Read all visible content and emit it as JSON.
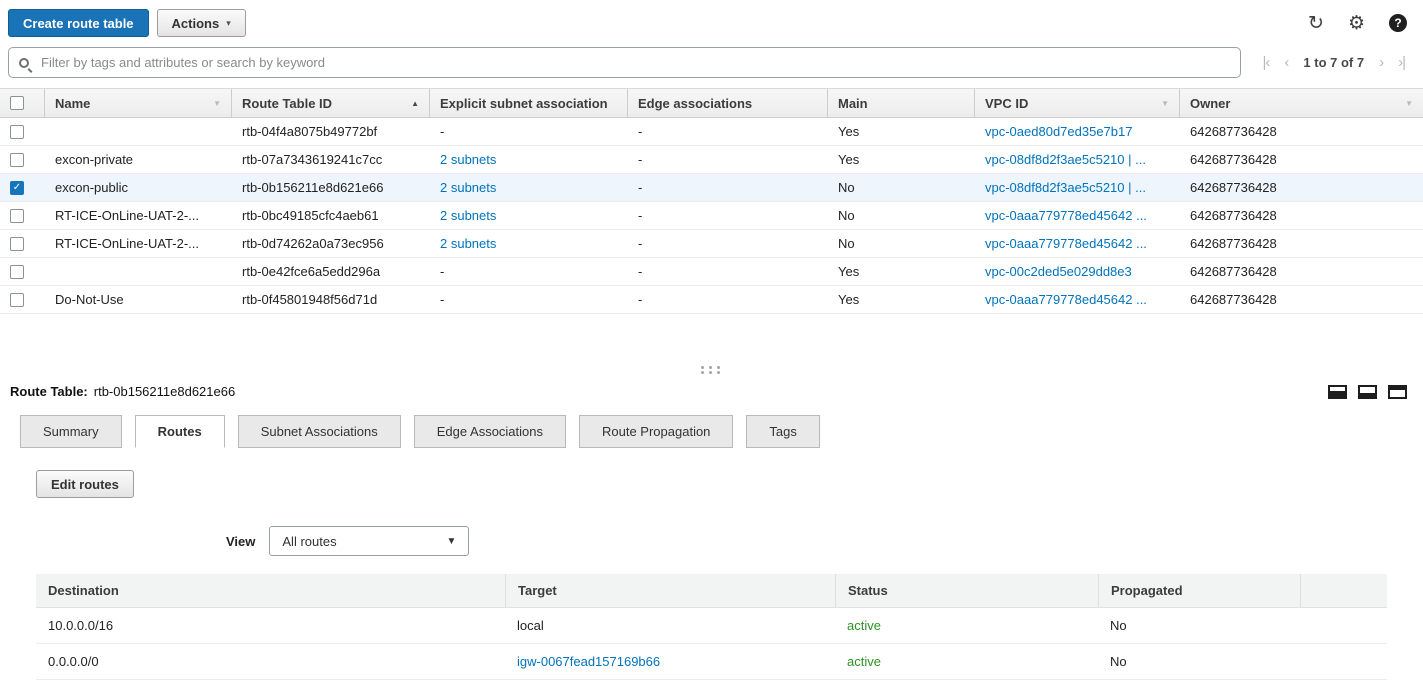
{
  "colors": {
    "primary_button": "#1a73b7",
    "link": "#0073bb",
    "status_active": "#2e9425",
    "selected_row": "#eef5fc",
    "checkbox_checked": "#1775bb"
  },
  "icons": {
    "refresh": "↻",
    "settings": "⚙",
    "help": "?",
    "check": "✓",
    "caret_down": "▼",
    "sort_asc": "▲",
    "sort_desc": "▼",
    "first_page": "|‹",
    "prev_page": "‹",
    "next_page": "›",
    "last_page": "›|",
    "actions_caret": "▾"
  },
  "toolbar": {
    "create_button": "Create route table",
    "actions_button": "Actions"
  },
  "filter": {
    "placeholder": "Filter by tags and attributes or search by keyword",
    "pagination_text": "1 to 7 of 7"
  },
  "main_table": {
    "columns": {
      "name": "Name",
      "route_table_id": "Route Table ID",
      "explicit_subnet_association": "Explicit subnet association",
      "edge_associations": "Edge associations",
      "main": "Main",
      "vpc_id": "VPC ID",
      "owner": "Owner"
    },
    "rows": [
      {
        "name": "",
        "id": "rtb-04f4a8075b49772bf",
        "subnets": "-",
        "edge": "-",
        "main": "Yes",
        "vpc": "vpc-0aed80d7ed35e7b17",
        "owner": "642687736428"
      },
      {
        "name": "excon-private",
        "id": "rtb-07a7343619241c7cc",
        "subnets": "2 subnets",
        "edge": "-",
        "main": "Yes",
        "vpc": "vpc-08df8d2f3ae5c5210 | ...",
        "owner": "642687736428"
      },
      {
        "name": "excon-public",
        "id": "rtb-0b156211e8d621e66",
        "subnets": "2 subnets",
        "edge": "-",
        "main": "No",
        "vpc": "vpc-08df8d2f3ae5c5210 | ...",
        "owner": "642687736428",
        "selected": true
      },
      {
        "name": "RT-ICE-OnLine-UAT-2-...",
        "id": "rtb-0bc49185cfc4aeb61",
        "subnets": "2 subnets",
        "edge": "-",
        "main": "No",
        "vpc": "vpc-0aaa779778ed45642 ...",
        "owner": "642687736428"
      },
      {
        "name": "RT-ICE-OnLine-UAT-2-...",
        "id": "rtb-0d74262a0a73ec956",
        "subnets": "2 subnets",
        "edge": "-",
        "main": "No",
        "vpc": "vpc-0aaa779778ed45642 ...",
        "owner": "642687736428"
      },
      {
        "name": "",
        "id": "rtb-0e42fce6a5edd296a",
        "subnets": "-",
        "edge": "-",
        "main": "Yes",
        "vpc": "vpc-00c2ded5e029dd8e3",
        "owner": "642687736428"
      },
      {
        "name": "Do-Not-Use",
        "id": "rtb-0f45801948f56d71d",
        "subnets": "-",
        "edge": "-",
        "main": "Yes",
        "vpc": "vpc-0aaa779778ed45642 ...",
        "owner": "642687736428"
      }
    ]
  },
  "detail": {
    "title_label": "Route Table:",
    "title_value": "rtb-0b156211e8d621e66",
    "tabs": [
      "Summary",
      "Routes",
      "Subnet Associations",
      "Edge Associations",
      "Route Propagation",
      "Tags"
    ],
    "active_tab": "Routes",
    "edit_routes_button": "Edit routes",
    "view_label": "View",
    "view_selected": "All routes",
    "routes_table": {
      "columns": [
        "Destination",
        "Target",
        "Status",
        "Propagated"
      ],
      "rows": [
        {
          "destination": "10.0.0.0/16",
          "target": "local",
          "status": "active",
          "propagated": "No"
        },
        {
          "destination": "0.0.0.0/0",
          "target": "igw-0067fead157169b66",
          "status": "active",
          "propagated": "No"
        }
      ]
    }
  }
}
